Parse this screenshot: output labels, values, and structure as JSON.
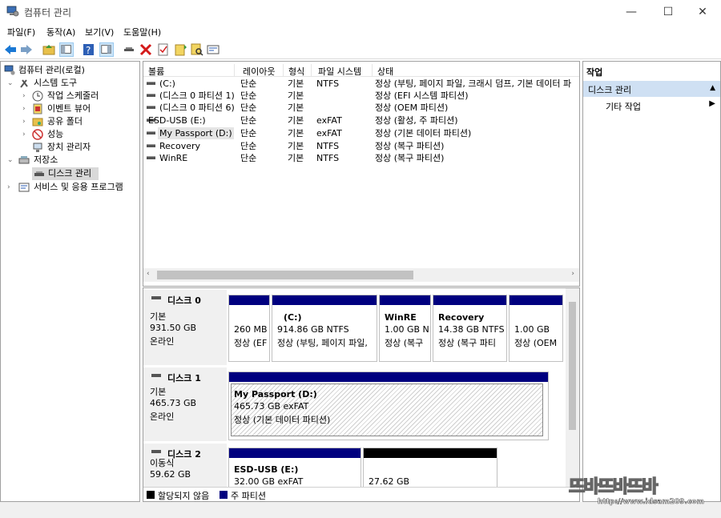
{
  "window": {
    "title": "컴퓨터 관리",
    "min": "—",
    "max": "☐",
    "close": "✕"
  },
  "menu": [
    "파일(F)",
    "동작(A)",
    "보기(V)",
    "도움말(H)"
  ],
  "toolbar": {
    "icons": [
      "back-arrow-icon",
      "forward-arrow-icon",
      "folder-up-icon",
      "show-hide-tree-icon",
      "help-icon",
      "show-hide-action-pane-icon",
      "connect-icon",
      "delete-icon",
      "properties-icon",
      "open-icon",
      "search-icon",
      "export-list-icon"
    ],
    "colors": {
      "back": "#1a78d4",
      "delete": "#d41a1a"
    }
  },
  "tree": {
    "root": "컴퓨터 관리(로컬)",
    "system_tools": "시스템 도구",
    "task_scheduler": "작업 스케줄러",
    "event_viewer": "이벤트 뷰어",
    "shared_folders": "공유 폴더",
    "performance": "성능",
    "device_manager": "장치 관리자",
    "storage": "저장소",
    "disk_management": "디스크 관리",
    "services_apps": "서비스 및 응용 프로그램"
  },
  "volume_list": {
    "headers": [
      "볼륨",
      "레이아웃",
      "형식",
      "파일 시스템",
      "상태"
    ],
    "rows": [
      {
        "volume": "(C:)",
        "layout": "단순",
        "type": "기본",
        "fs": "NTFS",
        "status": "정상 (부팅, 페이지 파일, 크래시 덤프, 기본 데이터 파"
      },
      {
        "volume": "(디스크 0 파티션 1)",
        "layout": "단순",
        "type": "기본",
        "fs": "",
        "status": "정상 (EFI 시스템 파티션)"
      },
      {
        "volume": "(디스크 0 파티션 6)",
        "layout": "단순",
        "type": "기본",
        "fs": "",
        "status": "정상 (OEM 파티션)"
      },
      {
        "volume": "ESD-USB (E:)",
        "layout": "단순",
        "type": "기본",
        "fs": "exFAT",
        "status": "정상 (활성, 주 파티션)"
      },
      {
        "volume": "My Passport (D:)",
        "layout": "단순",
        "type": "기본",
        "fs": "exFAT",
        "status": "정상 (기본 데이터 파티션)"
      },
      {
        "volume": "Recovery",
        "layout": "단순",
        "type": "기본",
        "fs": "NTFS",
        "status": "정상 (복구 파티션)"
      },
      {
        "volume": "WinRE",
        "layout": "단순",
        "type": "기본",
        "fs": "NTFS",
        "status": "정상 (복구 파티션)"
      }
    ]
  },
  "disks": [
    {
      "name": "디스크 0",
      "kind": "기본",
      "size": "931.50 GB",
      "state": "온라인",
      "partitions": [
        {
          "label": "",
          "size": "260 MB",
          "status": "정상 (EF"
        },
        {
          "label": "(C:)",
          "size": "914.86 GB NTFS",
          "status": "정상 (부팅, 페이지 파일,"
        },
        {
          "label": "WinRE",
          "size": "1.00 GB N",
          "status": "정상 (복구"
        },
        {
          "label": "Recovery",
          "size": "14.38 GB NTFS",
          "status": "정상 (복구 파티"
        },
        {
          "label": "",
          "size": "1.00 GB",
          "status": "정상 (OEM"
        }
      ]
    },
    {
      "name": "디스크 1",
      "kind": "기본",
      "size": "465.73 GB",
      "state": "온라인",
      "partitions": [
        {
          "label": "My Passport  (D:)",
          "size": "465.73 GB exFAT",
          "status": "정상 (기본 데이터 파티션)"
        }
      ]
    },
    {
      "name": "디스크 2",
      "kind": "이동식",
      "size": "59.62 GB",
      "state": "",
      "partitions": [
        {
          "label": "ESD-USB  (E:)",
          "size": "32.00 GB exFAT",
          "status": ""
        },
        {
          "label": "",
          "size": "27.62 GB",
          "status": ""
        }
      ]
    }
  ],
  "legend": {
    "unallocated": "할당되지 않음",
    "primary": "주 파티션",
    "unallocated_color": "#000000",
    "primary_color": "#00007f"
  },
  "actions": {
    "header": "작업",
    "section": "디스크 관리",
    "more": "기타 작업"
  },
  "watermark": {
    "text": "뜨바뜨바뜨바",
    "url": "http://www.idsam209.com"
  }
}
